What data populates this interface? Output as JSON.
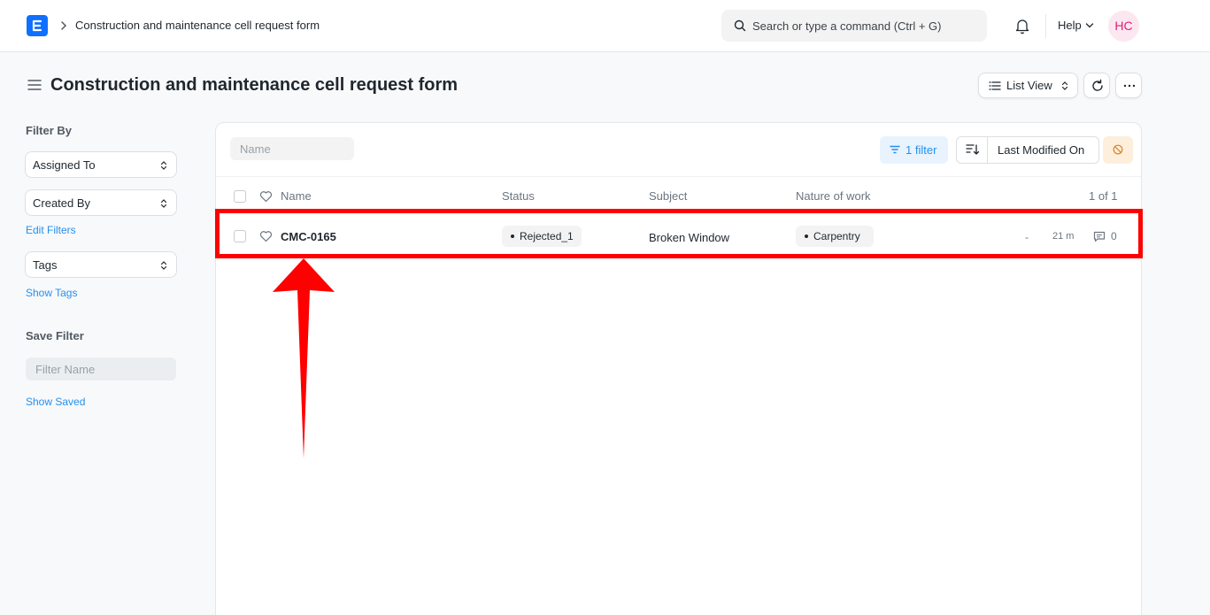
{
  "navbar": {
    "breadcrumb": "Construction and maintenance cell request form",
    "search_placeholder": "Search or type a command (Ctrl + G)",
    "help_label": "Help",
    "avatar_initials": "HC"
  },
  "page": {
    "title": "Construction and maintenance cell request form",
    "view_label": "List View"
  },
  "sidebar": {
    "filter_by_heading": "Filter By",
    "assigned_to": "Assigned To",
    "created_by": "Created By",
    "edit_filters": "Edit Filters",
    "tags": "Tags",
    "show_tags": "Show Tags",
    "save_filter_heading": "Save Filter",
    "filter_name_placeholder": "Filter Name",
    "show_saved": "Show Saved"
  },
  "list": {
    "name_placeholder": "Name",
    "filter_label": "1 filter",
    "sort_label": "Last Modified On",
    "columns": {
      "name": "Name",
      "status": "Status",
      "subject": "Subject",
      "nature": "Nature of work"
    },
    "count": "1 of 1",
    "rows": [
      {
        "name": "CMC-0165",
        "status": "Rejected_1",
        "subject": "Broken Window",
        "nature": "Carpentry",
        "assigned": "-",
        "modified": "21 m",
        "comments": "0"
      }
    ]
  },
  "colors": {
    "accent": "#2490ef",
    "logo": "#0f6fff",
    "annotation": "#ff0000"
  }
}
